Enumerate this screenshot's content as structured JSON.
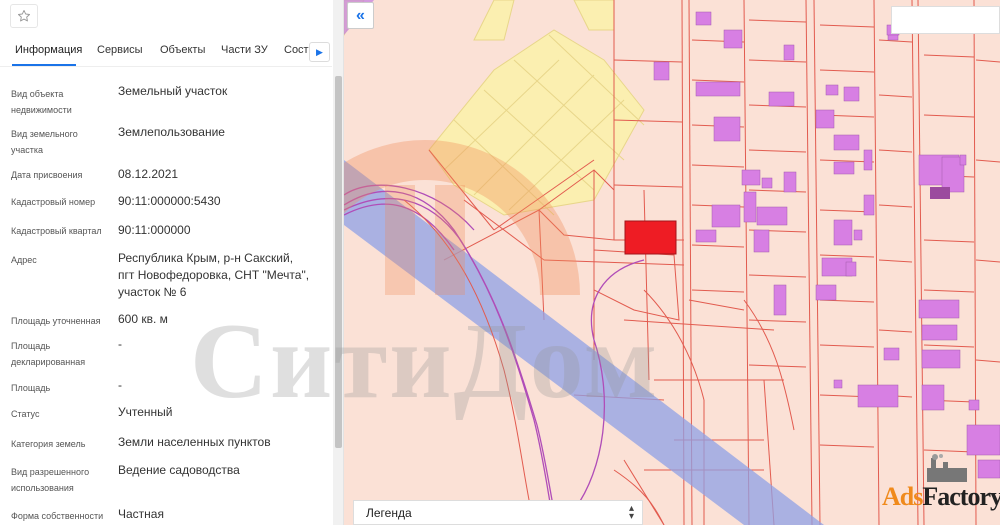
{
  "panel": {
    "tabs": [
      {
        "label": "Информация",
        "active": true
      },
      {
        "label": "Сервисы",
        "active": false
      },
      {
        "label": "Объекты",
        "active": false
      },
      {
        "label": "Части ЗУ",
        "active": false
      },
      {
        "label": "Соста",
        "active": false
      }
    ],
    "rows": [
      {
        "label": "Вид объекта недвижимости",
        "value": "Земельный участок"
      },
      {
        "label": "Вид земельного участка",
        "value": "Землепользование"
      },
      {
        "label": "Дата присвоения",
        "value": "08.12.2021"
      },
      {
        "label": "Кадастровый номер",
        "value": "90:11:000000:5430"
      },
      {
        "label": "Кадастровый квартал",
        "value": "90:11:000000"
      },
      {
        "label": "Адрес",
        "value": "Республика Крым, р-н Сакский, пгт Новофедоровка, СНТ \"Мечта\", участок № 6"
      },
      {
        "label": "Площадь уточненная",
        "value": "600 кв. м"
      },
      {
        "label": "Площадь декларированная",
        "value": "-"
      },
      {
        "label": "Площадь",
        "value": "-"
      },
      {
        "label": "Статус",
        "value": "Учтенный"
      },
      {
        "label": "Категория земель",
        "value": "Земли населенных пунктов"
      },
      {
        "label": "Вид разрешенного использования",
        "value": "Ведение садоводства"
      },
      {
        "label": "Форма собственности",
        "value": "Частная"
      }
    ]
  },
  "map": {
    "legend_label": "Легенда",
    "colors": {
      "parcel_fill": "#fbe1d6",
      "parcel_border": "#e25b4f",
      "building": "#d77fe3",
      "selected_parcel": "#ee1c24",
      "yellow_zone": "#fbefb0",
      "road_band": "#8fa0e6"
    }
  },
  "watermark": {
    "text": "СитиДом",
    "brand": "AdsFactory",
    "brand_prefix": "Ads",
    "brand_suffix": "Factory"
  },
  "icons": {
    "favorite": "star-icon",
    "collapse": "double-chevron-left-icon",
    "tabs_next": "chevron-right-icon",
    "legend_toggle": "up-down-arrows-icon"
  }
}
